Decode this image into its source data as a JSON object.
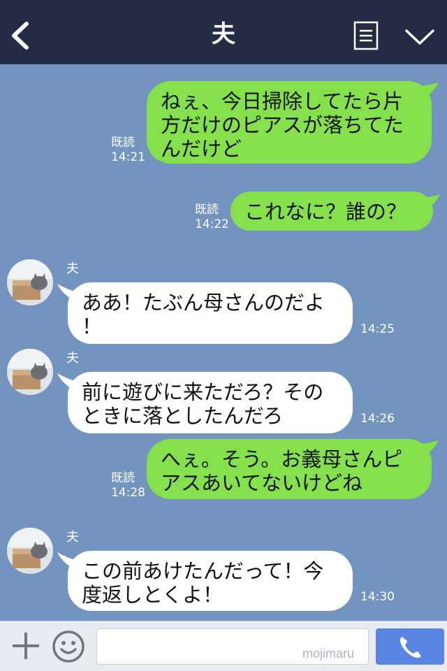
{
  "header": {
    "title": "夫",
    "back_icon": "chevron-left-icon",
    "menu_icon": "menu-list-icon",
    "collapse_icon": "chevron-down-icon",
    "bg_color": "#232b45"
  },
  "chat": {
    "bg_color": "#7494c0",
    "my_bubble_color": "#84e14c",
    "other_bubble_color": "#ffffff",
    "messages": [
      {
        "from": "me",
        "text": "ねぇ、今日掃除してたら片\n方だけのピアスが落ちてた\nんだけど",
        "read_label": "既読",
        "time": "14:21"
      },
      {
        "from": "me",
        "text": "これなに？誰の？",
        "read_label": "既読",
        "time": "14:22"
      },
      {
        "from": "other",
        "sender": "夫",
        "text": "ああ！たぶん母さんのだよ\n！",
        "time": "14:25"
      },
      {
        "from": "other",
        "sender": "夫",
        "text": "前に遊びに来ただろ？その\nときに落としたんだろ",
        "time": "14:26"
      },
      {
        "from": "me",
        "text": "へぇ。そう。お義母さんピ\nアスあいてないけどね",
        "read_label": "既読",
        "time": "14:28"
      },
      {
        "from": "other",
        "sender": "夫",
        "text": "この前あけたんだって！今\n度返しとくよ！",
        "time": "14:30"
      }
    ]
  },
  "footer": {
    "plus_icon": "plus-icon",
    "emoji_icon": "smiley-icon",
    "input_value": "",
    "call_icon": "phone-icon",
    "watermark": "mojimaru",
    "call_color": "#5b85e3"
  }
}
